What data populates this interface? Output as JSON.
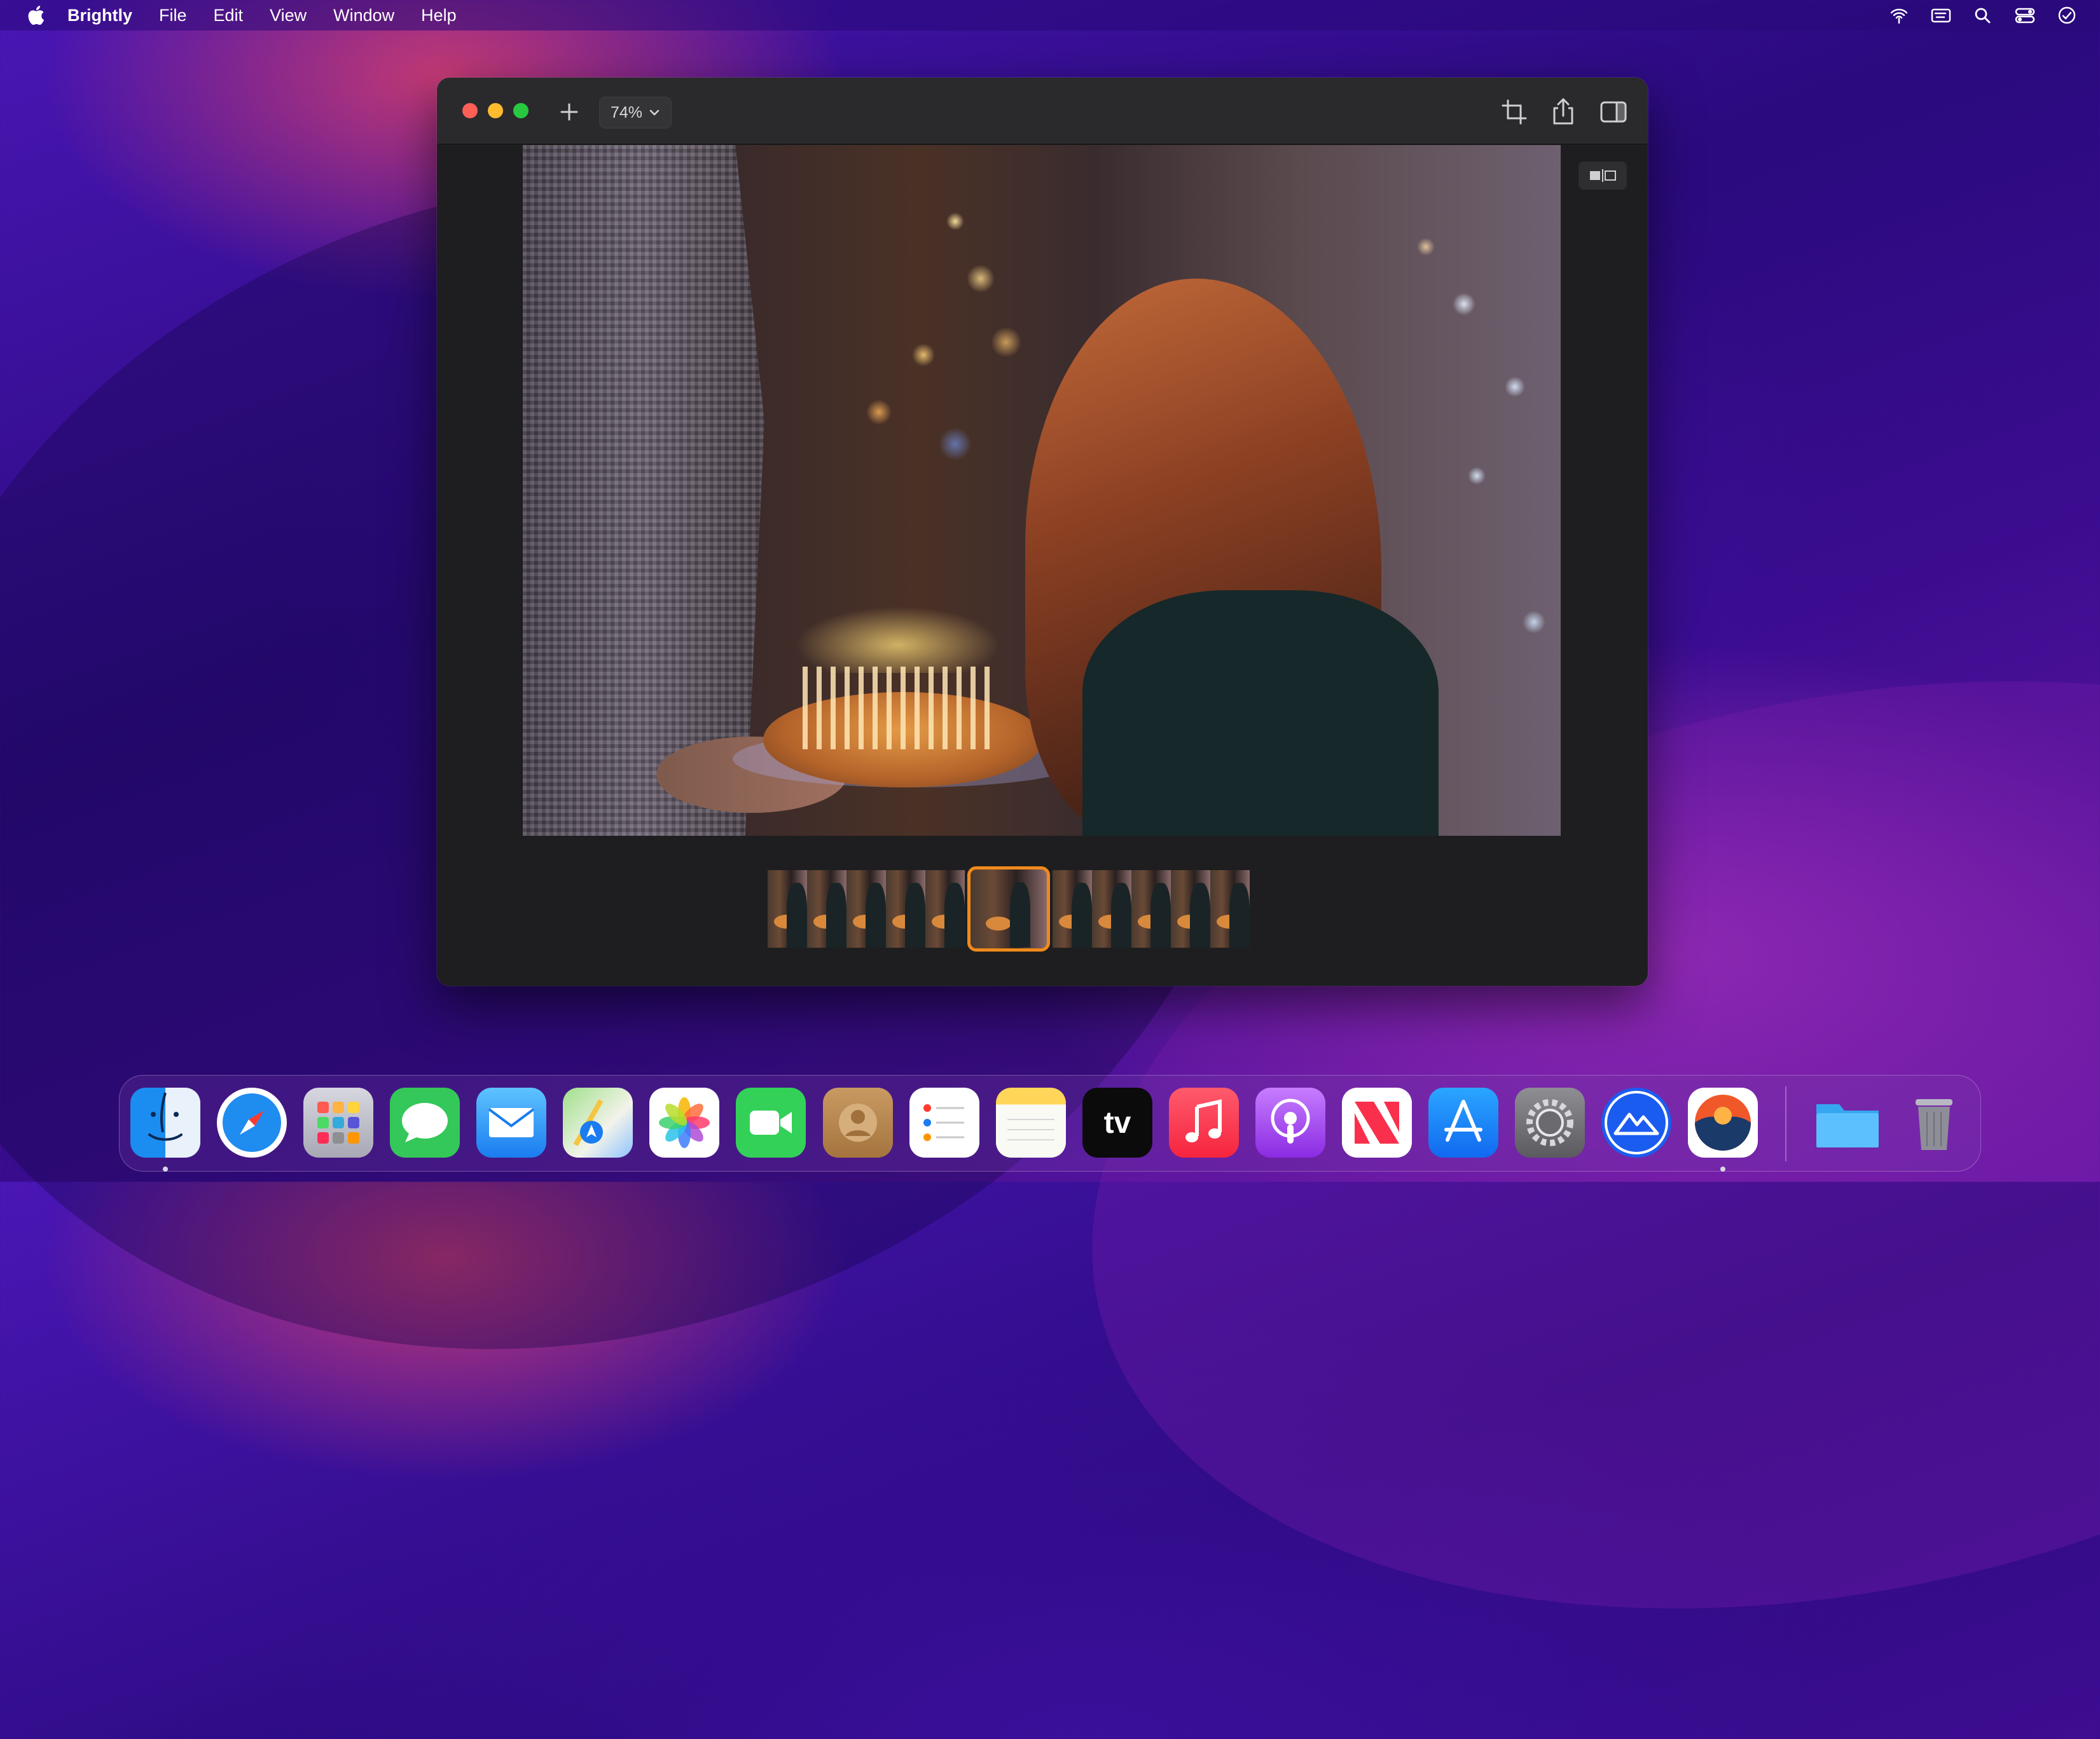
{
  "menubar": {
    "app_name": "Brightly",
    "items": [
      "File",
      "Edit",
      "View",
      "Window",
      "Help"
    ],
    "status_icons": [
      "wifi-icon",
      "keyboard-input-icon",
      "spotlight-search-icon",
      "control-center-icon",
      "clock-icon"
    ]
  },
  "window": {
    "zoom_level": "74%",
    "toolbar_icons": [
      "add-icon",
      "crop-icon",
      "share-icon",
      "sidebar-icon"
    ],
    "compare_icon": "before-after-compare-icon",
    "filmstrip": {
      "count": 11,
      "selected_index": 5
    }
  },
  "dock": {
    "apps": [
      "Finder",
      "Safari",
      "Launchpad",
      "Messages",
      "Mail",
      "Maps",
      "Photos",
      "FaceTime",
      "Contacts",
      "Reminders",
      "Notes",
      "TV",
      "Music",
      "Podcasts",
      "News",
      "App Store",
      "System Preferences",
      "Brightly",
      "Brightly Editor",
      "Downloads",
      "Trash"
    ],
    "tv_label": "tv"
  }
}
